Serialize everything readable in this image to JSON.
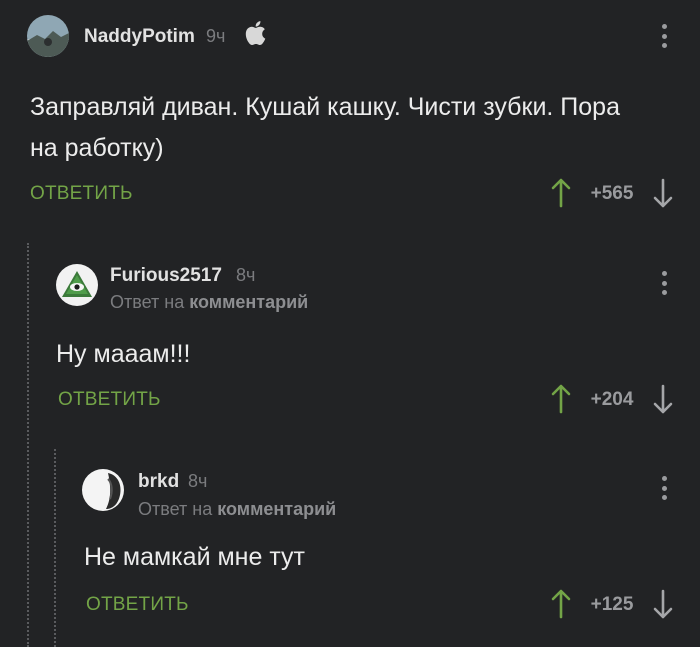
{
  "colors": {
    "background": "#222325",
    "accent_green": "#73a447",
    "muted": "#7b7c7f",
    "text": "#ececec"
  },
  "comments": [
    {
      "username": "NaddyPotim",
      "time": "9ч",
      "device_icon": "apple-icon",
      "text": "Заправляй диван. Кушай кашку. Чисти зубки. Пора на работку)",
      "reply_label": "ОТВЕТИТЬ",
      "score": "+565"
    },
    {
      "username": "Furious2517",
      "time": "8ч",
      "reply_prefix": "Ответ на",
      "reply_link": "комментарий",
      "text": "Ну мааам!!!",
      "reply_label": "ОТВЕТИТЬ",
      "score": "+204"
    },
    {
      "username": "brkd",
      "time": "8ч",
      "reply_prefix": "Ответ на",
      "reply_link": "комментарий",
      "text": "Не мамкай мне тут",
      "reply_label": "ОТВЕТИТЬ",
      "score": "+125"
    }
  ]
}
